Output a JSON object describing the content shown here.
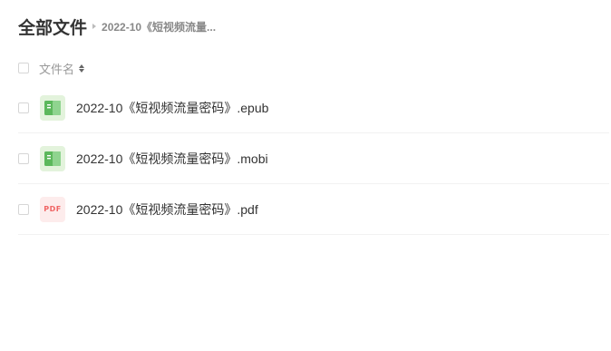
{
  "breadcrumb": {
    "root": "全部文件",
    "current": "2022-10《短视频流量..."
  },
  "list_header": {
    "name_column": "文件名"
  },
  "files": [
    {
      "name": "2022-10《短视频流量密码》.epub",
      "icon": "ebook-icon"
    },
    {
      "name": "2022-10《短视频流量密码》.mobi",
      "icon": "ebook-icon"
    },
    {
      "name": "2022-10《短视频流量密码》.pdf",
      "icon": "pdf-icon",
      "icon_text": "PDF"
    }
  ],
  "colors": {
    "ebook_icon_bg": "#e3f3dc",
    "ebook_icon_fg": "#5cb85c",
    "pdf_icon_bg": "#fdecec",
    "pdf_icon_fg": "#f06464"
  }
}
